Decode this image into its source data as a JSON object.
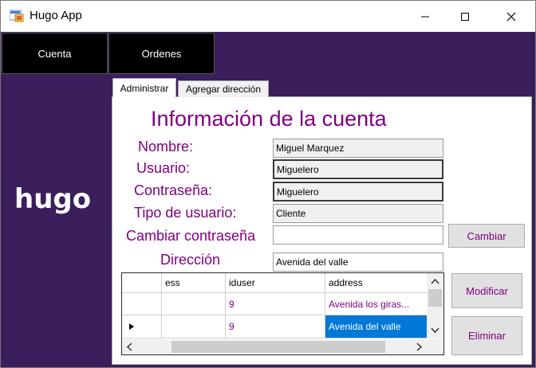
{
  "window": {
    "title": "Hugo App"
  },
  "nav": {
    "cuenta": "Cuenta",
    "ordenes": "Ordenes"
  },
  "logo": "hugo",
  "tabs": {
    "admin": "Administrar",
    "address": "Agregar dirección"
  },
  "account": {
    "heading": "Información de la cuenta",
    "nombre_label": "Nombre:",
    "nombre_value": "Miguel Marquez",
    "usuario_label": "Usuario:",
    "usuario_value": "Miguelero",
    "password_label": "Contraseña:",
    "password_value": "Miguelero",
    "tipo_label": "Tipo de usuario:",
    "tipo_value": "Cliente",
    "cambiar_label": "Cambiar contraseña",
    "cambiar_value": "",
    "cambiar_button": "Cambiar",
    "direccion_label": "Dirección",
    "direccion_value": "Avenida del valle"
  },
  "grid": {
    "columns": [
      "ess",
      "iduser",
      "address"
    ],
    "rows": [
      {
        "ess": "",
        "iduser": "9",
        "address": "Avenida los giras..."
      },
      {
        "ess": "",
        "iduser": "9",
        "address": "Avenida del valle"
      }
    ]
  },
  "actions": {
    "modificar": "Modificar",
    "eliminar": "Eliminar"
  },
  "colors": {
    "accent": "#800080",
    "background": "#3b1e5c",
    "selection": "#0078d7"
  }
}
